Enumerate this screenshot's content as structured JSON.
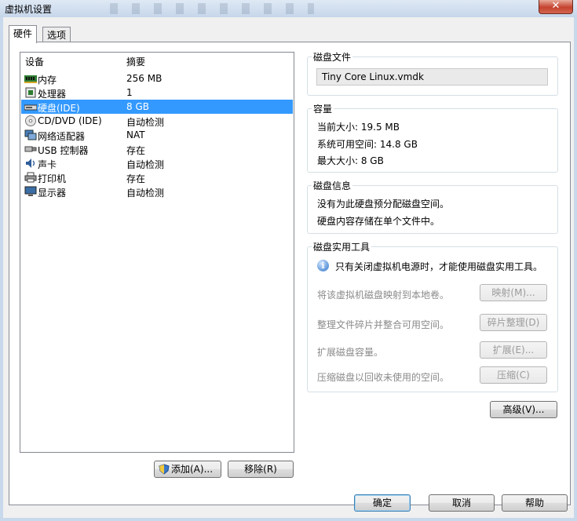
{
  "window": {
    "title": "虚拟机设置",
    "close_glyph": "✕"
  },
  "tabs": [
    {
      "label": "硬件",
      "active": true
    },
    {
      "label": "选项",
      "active": false
    }
  ],
  "device_list": {
    "columns": {
      "device": "设备",
      "summary": "摘要"
    },
    "rows": [
      {
        "icon": "memory-icon",
        "name": "内存",
        "summary": "256 MB",
        "selected": false
      },
      {
        "icon": "processor-icon",
        "name": "处理器",
        "summary": "1",
        "selected": false
      },
      {
        "icon": "hard-disk-icon",
        "name": "硬盘(IDE)",
        "summary": "8 GB",
        "selected": true
      },
      {
        "icon": "cd-dvd-icon",
        "name": "CD/DVD (IDE)",
        "summary": "自动检测",
        "selected": false
      },
      {
        "icon": "network-adapter-icon",
        "name": "网络适配器",
        "summary": "NAT",
        "selected": false
      },
      {
        "icon": "usb-icon",
        "name": "USB 控制器",
        "summary": "存在",
        "selected": false
      },
      {
        "icon": "sound-card-icon",
        "name": "声卡",
        "summary": "自动检测",
        "selected": false
      },
      {
        "icon": "printer-icon",
        "name": "打印机",
        "summary": "存在",
        "selected": false
      },
      {
        "icon": "display-icon",
        "name": "显示器",
        "summary": "自动检测",
        "selected": false
      }
    ],
    "add_button": "添加(A)...",
    "remove_button": "移除(R)"
  },
  "disk_file": {
    "title": "磁盘文件",
    "value": "Tiny Core Linux.vmdk"
  },
  "capacity": {
    "title": "容量",
    "current_size": "当前大小: 19.5 MB",
    "free_space": "系统可用空间: 14.8 GB",
    "max_size": "最大大小: 8 GB"
  },
  "disk_info": {
    "title": "磁盘信息",
    "line1": "没有为此硬盘预分配磁盘空间。",
    "line2": "硬盘内容存储在单个文件中。"
  },
  "disk_utilities": {
    "title": "磁盘实用工具",
    "notice": "只有关闭虚拟机电源时，才能使用磁盘实用工具。",
    "rows": [
      {
        "text": "将该虚拟机磁盘映射到本地卷。",
        "button": "映射(M)..."
      },
      {
        "text": "整理文件碎片并整合可用空间。",
        "button": "碎片整理(D)"
      },
      {
        "text": "扩展磁盘容量。",
        "button": "扩展(E)..."
      },
      {
        "text": "压缩磁盘以回收未使用的空间。",
        "button": "压缩(C)"
      }
    ]
  },
  "advanced_button": "高级(V)...",
  "footer": {
    "ok": "确定",
    "cancel": "取消",
    "help": "帮助"
  },
  "colors": {
    "selection": "#3399ff",
    "window_frame": "#c9d9ec",
    "close": "#c4432f"
  }
}
